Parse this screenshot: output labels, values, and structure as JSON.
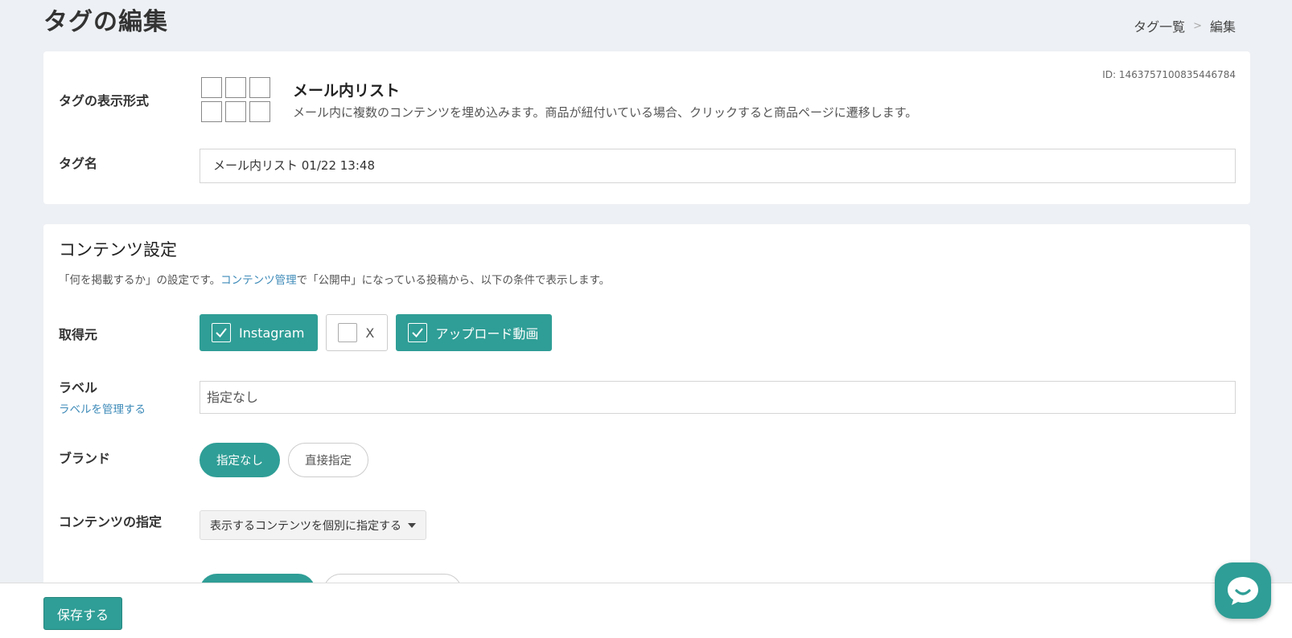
{
  "header": {
    "title": "タグの編集",
    "breadcrumb": {
      "parent": "タグ一覧",
      "separator": ">",
      "current": "編集"
    }
  },
  "tag_info": {
    "id_label": "ID: 1463757100835446784",
    "format_label": "タグの表示形式",
    "format_icon": "grid-icon",
    "format_title": "メール内リスト",
    "format_description": "メール内に複数のコンテンツを埋め込みます。商品が紐付いている場合、クリックすると商品ページに遷移します。",
    "name_label": "タグ名",
    "name_value": "メール内リスト 01/22 13:48"
  },
  "content_settings": {
    "title": "コンテンツ設定",
    "desc_before": "「何を掲載するか」の設定です。",
    "desc_link": "コンテンツ管理",
    "desc_after": "で「公開中」になっている投稿から、以下の条件で表示します。",
    "source_label": "取得元",
    "sources": [
      {
        "label": "Instagram",
        "checked": true
      },
      {
        "label": "X",
        "checked": false
      },
      {
        "label": "アップロード動画",
        "checked": true
      }
    ],
    "label_label": "ラベル",
    "label_manage_link": "ラベルを管理する",
    "label_value": "指定なし",
    "brand_label": "ブランド",
    "brand_options": [
      {
        "label": "指定なし",
        "selected": true
      },
      {
        "label": "直接指定",
        "selected": false
      }
    ],
    "content_spec_label": "コンテンツの指定",
    "content_spec_value": "表示するコンテンツを個別に指定する"
  },
  "footer": {
    "save_label": "保存する"
  },
  "chat": {
    "icon": "chat-icon"
  },
  "colors": {
    "accent": "#2f9e96",
    "link": "#3d8ab8",
    "background": "#edf0f4"
  }
}
